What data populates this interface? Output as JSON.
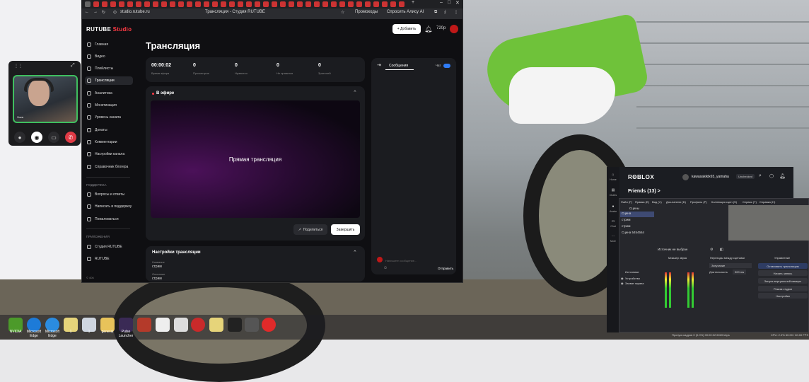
{
  "browser": {
    "url": "studio.rutube.ru",
    "page_title": "Трансляция - Студия RUTUBE",
    "bookmarks": [
      "Промокоды",
      "Спросить Алису AI"
    ]
  },
  "header": {
    "logo_main": "RUTUBE",
    "logo_studio": "Studio",
    "add_button": "+ Добавить",
    "quality": "720p"
  },
  "sidebar": {
    "items": [
      "Главная",
      "Видео",
      "Плейлисты",
      "Трансляции",
      "Аналитика",
      "Монетизация",
      "Уровень канала",
      "Донаты",
      "Комментарии",
      "Настройки канала",
      "Справочник блогера"
    ],
    "support_head": "ПОДДЕРЖКА",
    "support_items": [
      "Вопросы и ответы",
      "Написать в поддержку",
      "Пожаловаться"
    ],
    "apps_head": "ПРИЛОЖЕНИЯ",
    "apps_items": [
      "Студия RUTUBE",
      "RUTUBE"
    ],
    "footer": "© 406"
  },
  "main": {
    "title": "Трансляция",
    "stats": [
      {
        "value": "00:00:02",
        "label": "Время эфира"
      },
      {
        "value": "0",
        "label": "Просмотров"
      },
      {
        "value": "0",
        "label": "Нравится"
      },
      {
        "value": "0",
        "label": "Не нравится"
      },
      {
        "value": "0",
        "label": "Зрителей"
      }
    ],
    "live_title": "В эфире",
    "preview_text": "Прямая трансляция",
    "share_button": "Поделиться",
    "end_button": "Завершить",
    "settings_title": "Настройки трансляции",
    "settings": [
      {
        "label": "Название",
        "value": "стрим"
      },
      {
        "label": "Описание",
        "value": "стрим"
      }
    ]
  },
  "chat": {
    "tab": "Сообщения",
    "label": "Чат",
    "input_placeholder": "Напишите сообщение...",
    "send": "Отправить"
  },
  "call": {
    "name": "Vova"
  },
  "roblox": {
    "logo": "RΘBLOX",
    "user": "kawasakiklx65_yamaha",
    "badge": "Unchecked",
    "friends": "Friends (13) >",
    "side": [
      "Home",
      "Charts",
      "Avatar",
      "Chat",
      "More"
    ]
  },
  "obs": {
    "menu": [
      "Файл (F)",
      "Правка (E)",
      "Вид (V)",
      "Док-панели (D)",
      "Профиль (P)",
      "Коллекция сцен (S)",
      "Сервис (T)",
      "Справка (H)"
    ],
    "scenes_title": "Сцены",
    "scenes": [
      "Сцена",
      "стрим",
      "стрим",
      "Сцена 5454564"
    ],
    "no_source": "Источник не выбран",
    "docks": [
      "Источники",
      "Микшер звука",
      "Переходы между сценами",
      "Управление"
    ],
    "sources": [
      "Устройство",
      "Захват экрана"
    ],
    "transition": "Затухание",
    "duration_label": "Длительность",
    "duration": "300 ms",
    "controls": [
      "Остановить трансляцию",
      "Начать запись",
      "Запуск виртуальной камеры",
      "Режим студии",
      "Настройки"
    ],
    "status": "Пропуск кадров 0 (0.0%)   00:00:02   6020 kbps",
    "status_right": "CPU: 2.0%   60.00 / 60.00 FPS"
  },
  "taskbar": {
    "labels": [
      "NVIDIA",
      "Microsoft Edge",
      "Microsoft Edge",
      "1",
      "1",
      "general",
      "Pulse Launcher",
      "",
      "",
      "",
      "",
      "",
      "",
      "",
      ""
    ]
  }
}
